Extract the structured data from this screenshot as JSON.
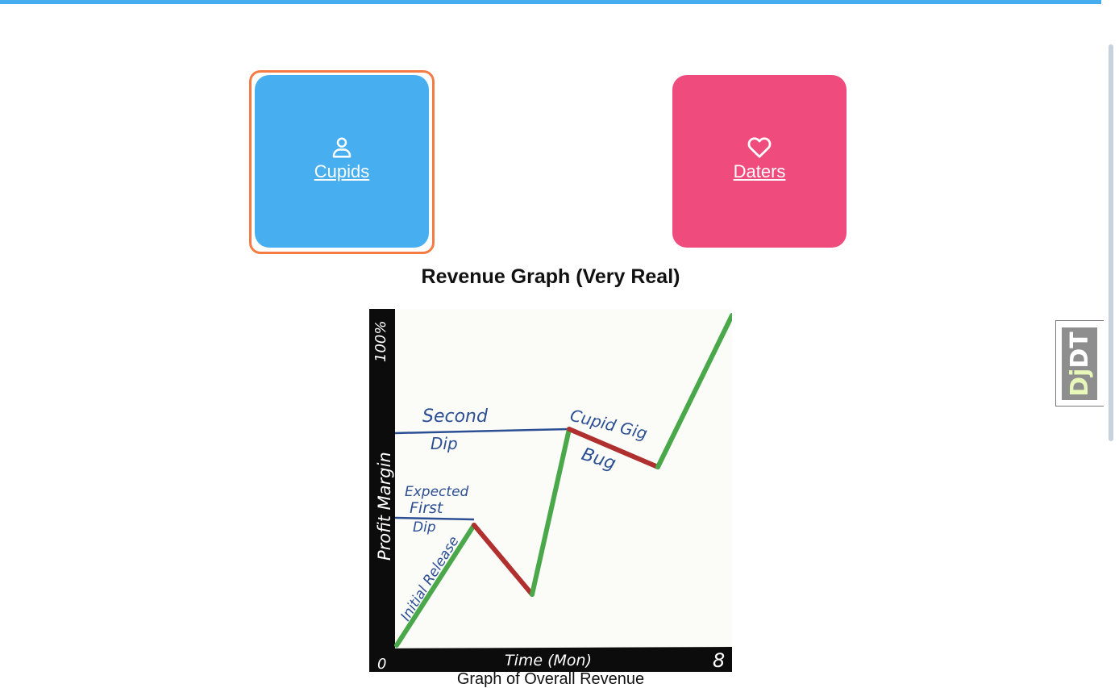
{
  "tiles": {
    "cupids": {
      "label": "Cupids",
      "icon": "user-icon",
      "color": "#47aeef"
    },
    "daters": {
      "label": "Daters",
      "icon": "heart-icon",
      "color": "#ef4b7d"
    },
    "focus_color": "#f47c44"
  },
  "graph": {
    "title": "Revenue Graph (Very Real)",
    "caption": "Graph of Overall Revenue",
    "image_text": {
      "y_axis": "Profit Margin",
      "y_max": "100%",
      "y_min": "0",
      "x_axis": "Time (Mon)",
      "x_max": "8",
      "annotations": [
        "Initial Release",
        "Expected First Dip",
        "Second Dip",
        "Cupid Gig Bug"
      ]
    }
  },
  "debug_toolbar": {
    "dj": "Dj",
    "dt": "DT"
  },
  "colors": {
    "topbar": "#45adef",
    "rise": "#4aa84a",
    "fall": "#b03030",
    "ink": "#2c4f94"
  }
}
